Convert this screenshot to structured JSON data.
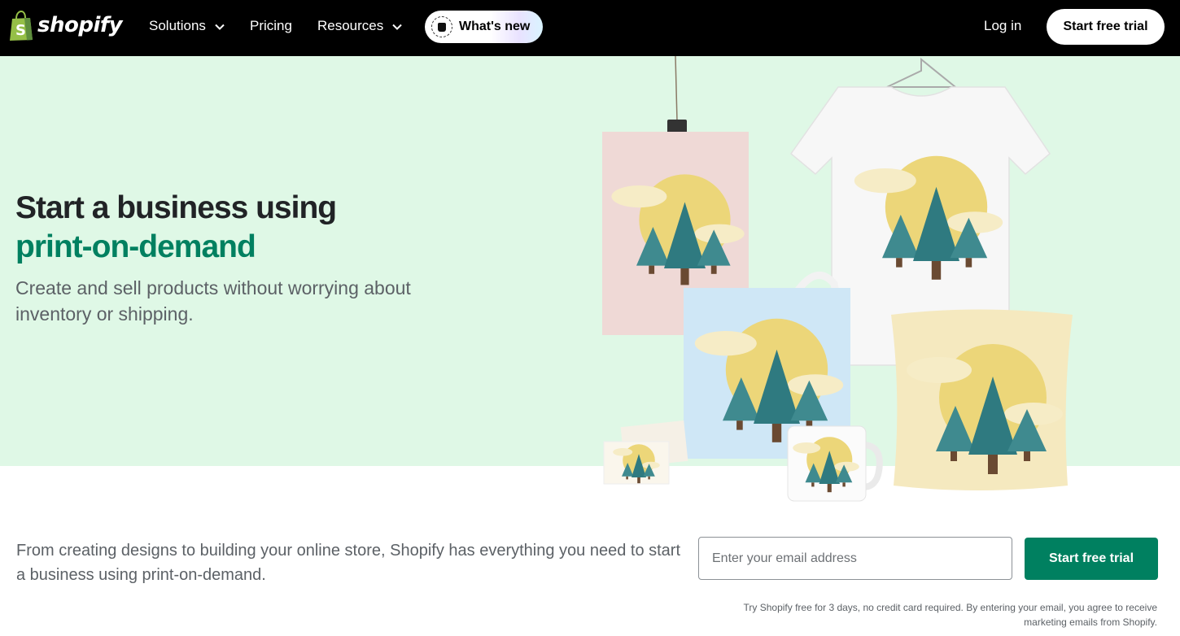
{
  "nav": {
    "brand": "shopify",
    "items": [
      {
        "label": "Solutions",
        "has_dropdown": true
      },
      {
        "label": "Pricing",
        "has_dropdown": false
      },
      {
        "label": "Resources",
        "has_dropdown": true
      }
    ],
    "whats_new_label": "What's new",
    "login_label": "Log in",
    "cta_label": "Start free trial"
  },
  "hero": {
    "headline_line1": "Start a business using",
    "headline_line2": "print-on-demand",
    "subheadline": "Create and sell products without worrying about inventory or shipping.",
    "background_color": "#dff8e6",
    "accent_color": "#008060",
    "product_icons": [
      "poster",
      "t-shirt",
      "tote-bag",
      "pillow",
      "mug",
      "greeting-card"
    ]
  },
  "signup": {
    "description": "From creating designs to building your online store, Shopify has everything you need to start a business using print-on-demand.",
    "email_placeholder": "Enter your email address",
    "email_value": "",
    "cta_label": "Start free trial",
    "cta_color": "#008060",
    "disclaimer": "Try Shopify free for 3 days, no credit card required. By entering your email, you agree to receive marketing emails from Shopify."
  }
}
